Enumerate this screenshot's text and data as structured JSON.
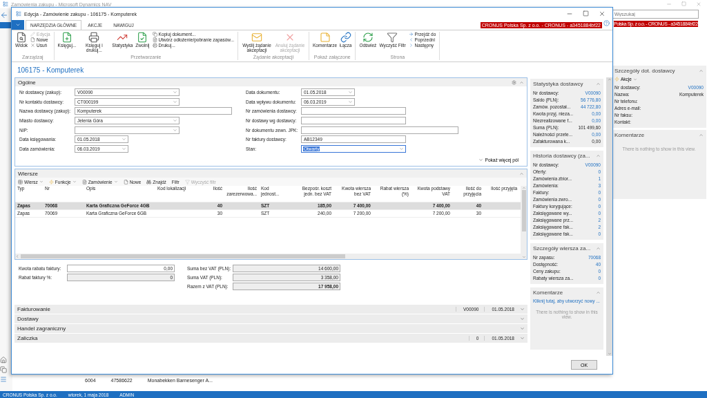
{
  "app": {
    "title": "Zamówienia zakupu - Microsoft Dynamics NAV",
    "search": {
      "placeholder": "Wyszukaj"
    },
    "company": "Polska Sp. z o.o. - CRONUS - a3451884bf22",
    "factbox": [
      {
        "kind": "fields",
        "title": "Szczegóły dot. dostawcy",
        "action": "Akcje",
        "rows": [
          {
            "label": "Nr dostawcy:",
            "value": "V00090",
            "link": true
          },
          {
            "label": "Nazwa:",
            "value": "Komputerek",
            "link": false
          },
          {
            "label": "Nr telefonu:"
          },
          {
            "label": "Adres e-mail:"
          },
          {
            "label": "Nr faksu:"
          },
          {
            "label": "Kontakt:"
          }
        ]
      },
      {
        "kind": "comments",
        "title": "Komentarze",
        "empty_text": "There is nothing to show in this view."
      }
    ],
    "list_row": [
      "6004",
      "47586622",
      "Monabekken Barnesenger A..."
    ],
    "status_bar": [
      "CRONUS Polska Sp. z o.o.",
      "wtorek, 1 maja 2018",
      "ADMIN"
    ]
  },
  "dialog": {
    "title": "Edycja - Zamówienie zakupu - 106175 - Komputerek",
    "tabs": [
      {
        "label": "NARZĘDZIA GŁÓWNE",
        "selected": true
      },
      {
        "label": "AKCJE",
        "selected": false
      },
      {
        "label": "NAWIGUJ",
        "selected": false
      }
    ],
    "company": "CRONUS Polska Sp. z o.o. - CRONUS - a3451884bf22",
    "ribbon": [
      {
        "label": "Zarządzaj",
        "large": [
          {
            "label": "Widok",
            "disabled": false
          }
        ],
        "small": [
          {
            "label": "Edycja",
            "disabled": true
          },
          {
            "label": "Nowe",
            "disabled": false
          },
          {
            "label": "Usuń",
            "disabled": false
          }
        ]
      },
      {
        "label": "Przetwarzanie",
        "large": [
          {
            "label": "Księguj...",
            "disabled": false
          },
          {
            "label": "Księguj i drukuj...",
            "disabled": false
          },
          {
            "label": "Statystyka",
            "disabled": false
          },
          {
            "label": "Zwolnij",
            "disabled": false
          }
        ],
        "small": [
          {
            "label": "Kopiuj dokument...",
            "disabled": false
          },
          {
            "label": "Utwórz odłożenie/pobranie zapasów...",
            "disabled": false
          },
          {
            "label": "Drukuj...",
            "disabled": false
          }
        ]
      },
      {
        "label": "Żądanie akceptacji",
        "large": [
          {
            "label": "Wyślij żądanie akceptacji",
            "disabled": false
          },
          {
            "label": "Anuluj żądanie akceptacji",
            "disabled": true
          }
        ]
      },
      {
        "label": "Pokaż załączone",
        "large": [
          {
            "label": "Komentarze",
            "disabled": false
          },
          {
            "label": "Łącza",
            "disabled": false
          }
        ]
      },
      {
        "label": "Strona",
        "large": [
          {
            "label": "Odśwież",
            "disabled": false
          },
          {
            "label": "Wyczyść Filtr",
            "disabled": false
          }
        ],
        "small": [
          {
            "label": "Przejdź do",
            "disabled": false
          },
          {
            "label": "Poprzedni",
            "disabled": false
          },
          {
            "label": "Następny",
            "disabled": false
          }
        ]
      }
    ],
    "page_title": "106175 - Komputerek",
    "general": {
      "title": "Ogólne",
      "left": [
        {
          "label": "Nr dostawcy (zakup):",
          "value": "V00090",
          "kind": "combo",
          "focused": false
        },
        {
          "label": "Nr kontaktu dostawcy:",
          "value": "CT000199",
          "kind": "combo",
          "focused": false
        },
        {
          "label": "Nazwa dostawcy (zakup):",
          "value": "Komputerek",
          "kind": "wide",
          "focused": false
        },
        {
          "label": "Miasto dostawcy:",
          "value": "Jelenia Góra",
          "kind": "combo",
          "focused": false
        },
        {
          "label": "NIP:",
          "kind": "combo",
          "focused": false
        },
        {
          "label": "Data księgowania:",
          "value": "01.05.2018",
          "kind": "date",
          "focused": false
        },
        {
          "label": "Data zamówienia:",
          "value": "06.03.2019",
          "kind": "date",
          "focused": false
        }
      ],
      "right": [
        {
          "label": "Data dokumentu:",
          "value": "01.05.2018",
          "kind": "date",
          "focused": false
        },
        {
          "label": "Data wpływu dokumentu:",
          "value": "06.03.2019",
          "kind": "date",
          "focused": false
        },
        {
          "label": "Nr zamówienia dostawcy:",
          "kind": "text",
          "focused": false
        },
        {
          "label": "Nr dostawy wg dostawcy:",
          "kind": "text",
          "focused": false
        },
        {
          "label": "Nr dokumentu zewn. JPK:",
          "kind": "wide",
          "focused": false
        },
        {
          "label": "Nr faktury dostawcy:",
          "value": "AB12349",
          "kind": "text",
          "focused": false
        },
        {
          "label": "Stan:",
          "value": "Otwarty",
          "kind": "combo",
          "focused": true
        }
      ],
      "more": "Pokaż więcej pól"
    },
    "lines": {
      "title": "Wiersze",
      "toolbar": [
        {
          "label": "Wiersz",
          "dropdown": true,
          "disabled": false
        },
        {
          "label": "Funkcje",
          "dropdown": true,
          "disabled": false
        },
        {
          "label": "Zamówienie",
          "dropdown": true,
          "disabled": false
        },
        {
          "label": "Nowe",
          "dropdown": false,
          "disabled": false
        },
        {
          "label": "Znajdź",
          "dropdown": false,
          "disabled": false
        },
        {
          "label": "Filtr",
          "dropdown": false,
          "disabled": false
        },
        {
          "label": "Wyczyść filtr",
          "dropdown": false,
          "disabled": true
        }
      ],
      "columns": [
        "Typ",
        "Nr",
        "Opis",
        "Kod lokalizacji",
        "Ilość",
        "Ilość zarezerwowa...",
        "Kod jednost...",
        "Bezpośr. koszt jedn. bez VAT",
        "Kwota wiersza bez VAT",
        "Rabat wiersza (%)",
        "Kwota podstawy VAT",
        "Ilość do przyjęcia",
        "Ilość przyjęta"
      ],
      "rows": [
        {
          "type": "Zapas",
          "no": "70068",
          "description": "Karta Graficzna GeForce  4GB",
          "quantity": "40",
          "unit": "SZT",
          "unit_cost": "185,00",
          "line_amount": "7 400,00",
          "vat_base": "7 400,00",
          "qty_to_receive": "40",
          "selected": true
        },
        {
          "type": "Zapas",
          "no": "70069",
          "description": "Karta Graficzna GeForce  6GB",
          "quantity": "30",
          "unit": "SZT",
          "unit_cost": "240,00",
          "line_amount": "7 200,00",
          "vat_base": "7 200,00",
          "qty_to_receive": "30",
          "selected": false
        }
      ]
    },
    "totals": {
      "left": [
        {
          "label": "Kwota rabatu faktury:",
          "value": "0,00",
          "editable": true
        },
        {
          "label": "Rabat faktury %:",
          "value": "0",
          "editable": false
        }
      ],
      "right": [
        {
          "label": "Suma bez VAT (PLN):",
          "value": "14 600,00",
          "bold": false
        },
        {
          "label": "Suma VAT (PLN):",
          "value": "3 358,00",
          "bold": false
        },
        {
          "label": "Razem z VAT (PLN):",
          "value": "17 958,00",
          "bold": true
        }
      ]
    },
    "sections": [
      {
        "title": "Fakturowanie",
        "summary": [
          "V00090",
          "01.05.2018"
        ]
      },
      {
        "title": "Dostawy"
      },
      {
        "title": "Handel zagraniczny"
      },
      {
        "title": "Zaliczka",
        "summary": [
          "0",
          "01.05.2018"
        ]
      }
    ],
    "factbox": [
      {
        "kind": "fields",
        "title": "Statystyka dostawcy",
        "rows": [
          {
            "label": "Nr dostawcy:",
            "value": "V00090",
            "link": true
          },
          {
            "label": "Saldo (PLN):",
            "value": "56 776,80",
            "link": true
          },
          {
            "label": "Zamów. pozostał...",
            "value": "44 722,80",
            "link": true
          },
          {
            "label": "Kwota przyj. nieza...",
            "value": "0,00",
            "link": true
          },
          {
            "label": "Niezrealizowane f...",
            "value": "0,00",
            "link": true
          },
          {
            "label": "Suma (PLN):",
            "value": "101 499,60",
            "link": false
          },
          {
            "label": "Należności przete...",
            "value": "0,00",
            "link": true
          },
          {
            "label": "Zafakturowana k...",
            "value": "0,00",
            "link": false
          }
        ]
      },
      {
        "kind": "fields",
        "title": "Historia dostawcy (za...",
        "rows": [
          {
            "label": "Nr dostawcy:",
            "value": "V00090",
            "link": true
          },
          {
            "label": "Oferty:",
            "value": "0",
            "link": true
          },
          {
            "label": "Zamówienia zbior...",
            "value": "1",
            "link": true
          },
          {
            "label": "Zamówienia:",
            "value": "3",
            "link": true
          },
          {
            "label": "Faktury:",
            "value": "0",
            "link": true
          },
          {
            "label": "Zamówienia zwro...",
            "value": "0",
            "link": true
          },
          {
            "label": "Faktury korygujące:",
            "value": "0",
            "link": true
          },
          {
            "label": "Zaksięgowane wy...",
            "value": "0",
            "link": true
          },
          {
            "label": "Zaksięgowane prz...",
            "value": "2",
            "link": true
          },
          {
            "label": "Zaksięgowane fak...",
            "value": "2",
            "link": true
          },
          {
            "label": "Zaksięgowane fak...",
            "value": "0",
            "link": true
          }
        ]
      },
      {
        "kind": "fields",
        "title": "Szczegóły wiersza za...",
        "rows": [
          {
            "label": "Nr zapasu:",
            "value": "70068",
            "link": true
          },
          {
            "label": "Dostępność:",
            "value": "40",
            "link": true
          },
          {
            "label": "Ceny zakupu:",
            "value": "0",
            "link": true
          },
          {
            "label": "Rabaty wiersza za...",
            "value": "0",
            "link": true
          }
        ]
      },
      {
        "kind": "comments",
        "title": "Komentarze",
        "link": "Kliknij tutaj, aby utworzyć nowy ...",
        "empty_text": "There is nothing to show in this view."
      }
    ],
    "ok": "OK"
  }
}
